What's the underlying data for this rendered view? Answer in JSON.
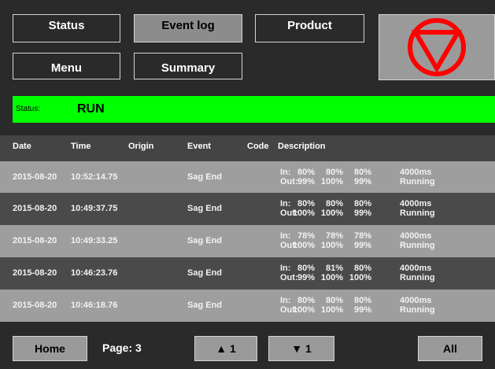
{
  "nav": {
    "status": "Status",
    "event_log": "Event log",
    "product": "Product",
    "menu": "Menu",
    "summary": "Summary"
  },
  "status": {
    "label": "Status:",
    "value": "RUN"
  },
  "table": {
    "headers": [
      "Date",
      "Time",
      "Origin",
      "Event",
      "Code",
      "Description"
    ],
    "in_label": "In:",
    "out_label": "Out:",
    "rows": [
      {
        "date": "2015-08-20",
        "time": "10:52:14.75",
        "origin": "",
        "event": "Sag End",
        "code": "",
        "in": [
          "80%",
          "80%",
          "80%",
          "4000ms"
        ],
        "out": [
          "99%",
          "100%",
          "99%",
          "Running"
        ]
      },
      {
        "date": "2015-08-20",
        "time": "10:49:37.75",
        "origin": "",
        "event": "Sag End",
        "code": "",
        "in": [
          "80%",
          "80%",
          "80%",
          "4000ms"
        ],
        "out": [
          "100%",
          "100%",
          "99%",
          "Running"
        ]
      },
      {
        "date": "2015-08-20",
        "time": "10:49:33.25",
        "origin": "",
        "event": "Sag End",
        "code": "",
        "in": [
          "78%",
          "78%",
          "78%",
          "4000ms"
        ],
        "out": [
          "100%",
          "100%",
          "99%",
          "Running"
        ]
      },
      {
        "date": "2015-08-20",
        "time": "10:46:23.76",
        "origin": "",
        "event": "Sag End",
        "code": "",
        "in": [
          "80%",
          "81%",
          "80%",
          "4000ms"
        ],
        "out": [
          "99%",
          "100%",
          "100%",
          "Running"
        ]
      },
      {
        "date": "2015-08-20",
        "time": "10:46:18.76",
        "origin": "",
        "event": "Sag End",
        "code": "",
        "in": [
          "80%",
          "80%",
          "80%",
          "4000ms"
        ],
        "out": [
          "100%",
          "100%",
          "99%",
          "Running"
        ]
      }
    ]
  },
  "footer": {
    "home": "Home",
    "page": "Page: 3",
    "up": "▲ 1",
    "down": "▼ 1",
    "all": "All"
  },
  "colors": {
    "status_green": "#00ff00",
    "stop_red": "#ff0000",
    "row_light": "#9e9e9e",
    "row_dark": "#4a4a4a"
  },
  "icons": {
    "stop": "stop-triangle-icon"
  }
}
